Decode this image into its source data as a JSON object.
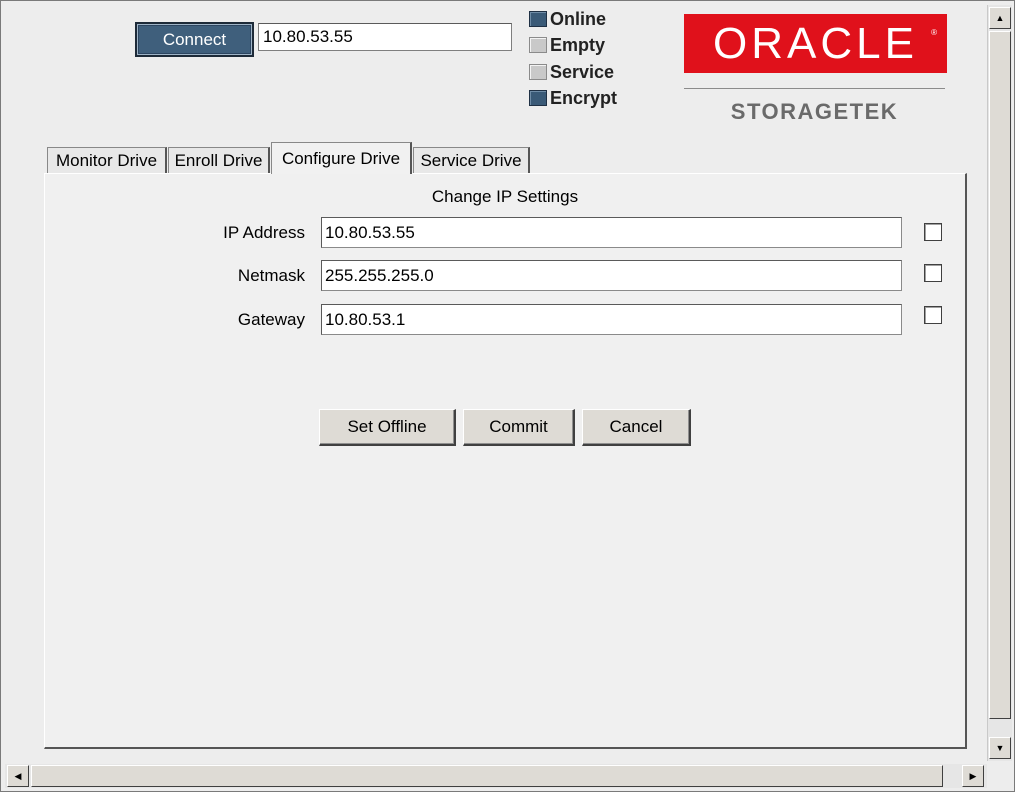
{
  "toolbar": {
    "connect_label": "Connect",
    "address_value": "10.80.53.55"
  },
  "status": {
    "items": [
      {
        "label": "Online",
        "state": "on"
      },
      {
        "label": "Empty",
        "state": "off"
      },
      {
        "label": "Service",
        "state": "off"
      },
      {
        "label": "Encrypt",
        "state": "on"
      }
    ]
  },
  "brand": {
    "logo_text": "ORACLE",
    "logo_mark": "®",
    "sub_brand": "STORAGETEK",
    "logo_color": "#e0111b"
  },
  "tabs": [
    {
      "label": "Monitor Drive",
      "active": false
    },
    {
      "label": "Enroll Drive",
      "active": false
    },
    {
      "label": "Configure Drive",
      "active": true
    },
    {
      "label": "Service Drive",
      "active": false
    }
  ],
  "panel": {
    "title": "Change IP Settings",
    "fields": [
      {
        "label": "IP Address",
        "value": "10.80.53.55",
        "checked": false
      },
      {
        "label": "Netmask",
        "value": "255.255.255.0",
        "checked": false
      },
      {
        "label": "Gateway",
        "value": "10.80.53.1",
        "checked": false
      }
    ],
    "buttons": {
      "set_offline": "Set Offline",
      "commit": "Commit",
      "cancel": "Cancel"
    }
  },
  "icons": {
    "up": "▲",
    "down": "▼",
    "left": "◀",
    "right": "▶"
  }
}
